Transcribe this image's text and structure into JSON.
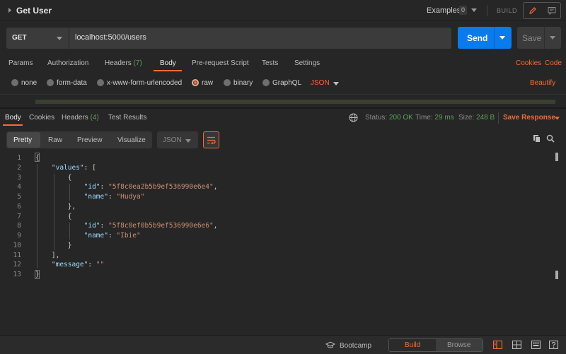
{
  "header": {
    "request_title": "Get User",
    "examples_label": "Examples",
    "examples_count": "0",
    "build_label": "BUILD"
  },
  "url_bar": {
    "method": "GET",
    "url": "localhost:5000/users",
    "send_label": "Send",
    "save_label": "Save"
  },
  "request_tabs": [
    {
      "label": "Params"
    },
    {
      "label": "Authorization"
    },
    {
      "label": "Headers",
      "count": "(7)"
    },
    {
      "label": "Body"
    },
    {
      "label": "Pre-request Script"
    },
    {
      "label": "Tests"
    },
    {
      "label": "Settings"
    }
  ],
  "request_links": {
    "cookies": "Cookies",
    "code": "Code"
  },
  "body_types": [
    {
      "label": "none",
      "selected": false
    },
    {
      "label": "form-data",
      "selected": false
    },
    {
      "label": "x-www-form-urlencoded",
      "selected": false
    },
    {
      "label": "raw",
      "selected": true
    },
    {
      "label": "binary",
      "selected": false
    },
    {
      "label": "GraphQL",
      "selected": false
    }
  ],
  "raw_format": "JSON",
  "beautify_label": "Beautify",
  "response_tabs": [
    {
      "label": "Body"
    },
    {
      "label": "Cookies"
    },
    {
      "label": "Headers",
      "count": "(4)"
    },
    {
      "label": "Test Results"
    }
  ],
  "response_meta": {
    "status_label": "Status:",
    "status_value": "200 OK",
    "time_label": "Time:",
    "time_value": "29 ms",
    "size_label": "Size:",
    "size_value": "248 B",
    "save_response": "Save Response"
  },
  "view_modes": [
    "Pretty",
    "Raw",
    "Preview",
    "Visualize"
  ],
  "response_format": "JSON",
  "code_lines": [
    {
      "n": "1",
      "tokens": [
        {
          "t": "{",
          "c": "p"
        }
      ]
    },
    {
      "n": "2",
      "tokens": [
        {
          "t": "    ",
          "c": "p"
        },
        {
          "t": "\"values\"",
          "c": "k"
        },
        {
          "t": ": [",
          "c": "p"
        }
      ]
    },
    {
      "n": "3",
      "tokens": [
        {
          "t": "        {",
          "c": "p"
        }
      ]
    },
    {
      "n": "4",
      "tokens": [
        {
          "t": "            ",
          "c": "p"
        },
        {
          "t": "\"id\"",
          "c": "k"
        },
        {
          "t": ": ",
          "c": "p"
        },
        {
          "t": "\"5f8c0ea2b5b9ef536990e6e4\"",
          "c": "s"
        },
        {
          "t": ",",
          "c": "p"
        }
      ]
    },
    {
      "n": "5",
      "tokens": [
        {
          "t": "            ",
          "c": "p"
        },
        {
          "t": "\"name\"",
          "c": "k"
        },
        {
          "t": ": ",
          "c": "p"
        },
        {
          "t": "\"Hudya\"",
          "c": "s"
        }
      ]
    },
    {
      "n": "6",
      "tokens": [
        {
          "t": "        },",
          "c": "p"
        }
      ]
    },
    {
      "n": "7",
      "tokens": [
        {
          "t": "        {",
          "c": "p"
        }
      ]
    },
    {
      "n": "8",
      "tokens": [
        {
          "t": "            ",
          "c": "p"
        },
        {
          "t": "\"id\"",
          "c": "k"
        },
        {
          "t": ": ",
          "c": "p"
        },
        {
          "t": "\"5f8c0ef0b5b9ef536990e6e6\"",
          "c": "s"
        },
        {
          "t": ",",
          "c": "p"
        }
      ]
    },
    {
      "n": "9",
      "tokens": [
        {
          "t": "            ",
          "c": "p"
        },
        {
          "t": "\"name\"",
          "c": "k"
        },
        {
          "t": ": ",
          "c": "p"
        },
        {
          "t": "\"Ibie\"",
          "c": "s"
        }
      ]
    },
    {
      "n": "10",
      "tokens": [
        {
          "t": "        }",
          "c": "p"
        }
      ]
    },
    {
      "n": "11",
      "tokens": [
        {
          "t": "    ],",
          "c": "p"
        }
      ]
    },
    {
      "n": "12",
      "tokens": [
        {
          "t": "    ",
          "c": "p"
        },
        {
          "t": "\"message\"",
          "c": "k"
        },
        {
          "t": ": ",
          "c": "p"
        },
        {
          "t": "\"\"",
          "c": "s"
        }
      ]
    },
    {
      "n": "13",
      "tokens": [
        {
          "t": "}",
          "c": "p"
        }
      ]
    }
  ],
  "statusbar": {
    "bootcamp_label": "Bootcamp",
    "build_tab": "Build",
    "browse_tab": "Browse"
  },
  "colors": {
    "accent": "#f26b3a",
    "send_blue": "#097bed",
    "ok_green": "#5aa05a",
    "json_key": "#9cdcfe",
    "json_string": "#ce9178"
  }
}
